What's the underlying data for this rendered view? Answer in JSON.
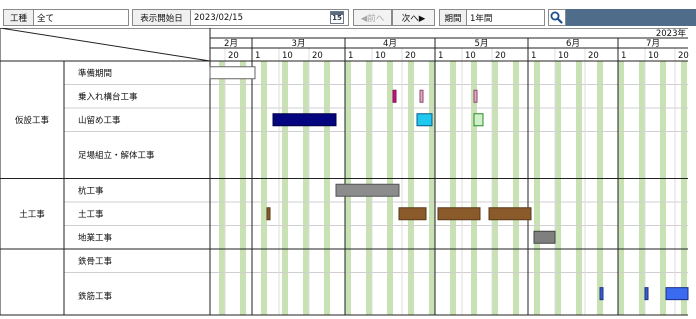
{
  "toolbar": {
    "type_label": "工種",
    "type_value": "全て",
    "start_label": "表示開始日",
    "start_value": "2023/02/15",
    "calendar_icon": "calendar-15-icon",
    "calendar_day": "15",
    "prev_label": "◀前へ",
    "next_label": "次へ▶",
    "period_label": "期間",
    "period_value": "1年間",
    "search_icon": "magnifier-icon"
  },
  "chart_data": {
    "type": "gantt",
    "year_label": "2023年",
    "start_date": "2023-02-15",
    "months": [
      {
        "label": "2月",
        "start": "2023-02-15",
        "end": "2023-03-01"
      },
      {
        "label": "3月",
        "start": "2023-03-01",
        "end": "2023-04-01"
      },
      {
        "label": "4月",
        "start": "2023-04-01",
        "end": "2023-05-01"
      },
      {
        "label": "5月",
        "start": "2023-05-01",
        "end": "2023-06-01"
      },
      {
        "label": "6月",
        "start": "2023-06-01",
        "end": "2023-07-01"
      },
      {
        "label": "7月",
        "start": "2023-07-01",
        "end": "2023-08-01"
      }
    ],
    "day_ticks": [
      {
        "date": "2023-02-20",
        "label": "20"
      },
      {
        "date": "2023-03-01",
        "label": "1"
      },
      {
        "date": "2023-03-10",
        "label": "10"
      },
      {
        "date": "2023-03-20",
        "label": "20"
      },
      {
        "date": "2023-04-01",
        "label": "1"
      },
      {
        "date": "2023-04-10",
        "label": "10"
      },
      {
        "date": "2023-04-20",
        "label": "20"
      },
      {
        "date": "2023-05-01",
        "label": "1"
      },
      {
        "date": "2023-05-10",
        "label": "10"
      },
      {
        "date": "2023-05-20",
        "label": "20"
      },
      {
        "date": "2023-06-01",
        "label": "1"
      },
      {
        "date": "2023-06-10",
        "label": "10"
      },
      {
        "date": "2023-06-20",
        "label": "20"
      },
      {
        "date": "2023-07-01",
        "label": "1"
      },
      {
        "date": "2023-07-10",
        "label": "10"
      },
      {
        "date": "2023-07-20",
        "label": "20"
      }
    ],
    "weekend_shading": true,
    "weekend_color": "#c8e2b4",
    "groups": [
      {
        "label": "仮設工事",
        "rows": [
          {
            "label": "準備期間",
            "height": 1,
            "bars": [
              {
                "start": "2023-02-15",
                "end": "2023-03-02",
                "color": "#ffffff",
                "stroke": "#666666",
                "lane": 0
              }
            ]
          },
          {
            "label": "乗入れ構台工事",
            "height": 1,
            "bars": [
              {
                "start": "2023-04-17",
                "end": "2023-04-18",
                "color": "#c0147d",
                "stroke": "#8a0f59",
                "lane": 0
              },
              {
                "start": "2023-04-26",
                "end": "2023-04-27",
                "color": "#e8a6c6",
                "stroke": "#8a4a6a",
                "lane": 0
              },
              {
                "start": "2023-05-14",
                "end": "2023-05-15",
                "color": "#e8a6c6",
                "stroke": "#8a4a6a",
                "lane": 0
              }
            ]
          },
          {
            "label": "山留め工事",
            "height": 1,
            "bars": [
              {
                "start": "2023-03-08",
                "end": "2023-03-29",
                "color": "#050580",
                "stroke": "#000040",
                "lane": 0
              },
              {
                "start": "2023-04-25",
                "end": "2023-04-30",
                "color": "#1ec8ee",
                "stroke": "#0a5a8a",
                "lane": 0
              },
              {
                "start": "2023-05-14",
                "end": "2023-05-17",
                "color": "#cdf0c8",
                "stroke": "#2a8a2a",
                "lane": 0
              }
            ]
          },
          {
            "label": "足場組立・解体工事",
            "height": 2,
            "bars": []
          }
        ]
      },
      {
        "label": "土工事",
        "rows": [
          {
            "label": "杭工事",
            "height": 1,
            "bars": [
              {
                "start": "2023-03-29",
                "end": "2023-04-19",
                "color": "#8c8c8c",
                "stroke": "#555555",
                "lane": 0
              }
            ]
          },
          {
            "label": "土工事",
            "height": 1,
            "bars": [
              {
                "start": "2023-03-06",
                "end": "2023-03-07",
                "color": "#8b5a2b",
                "stroke": "#5a3a1a",
                "lane": 0
              },
              {
                "start": "2023-04-19",
                "end": "2023-04-28",
                "color": "#8b5a2b",
                "stroke": "#5a3a1a",
                "lane": 0
              },
              {
                "start": "2023-05-02",
                "end": "2023-05-16",
                "color": "#8b5a2b",
                "stroke": "#5a3a1a",
                "lane": 0
              },
              {
                "start": "2023-05-19",
                "end": "2023-06-02",
                "color": "#8b5a2b",
                "stroke": "#5a3a1a",
                "lane": 0
              }
            ]
          },
          {
            "label": "地業工事",
            "height": 1,
            "bars": [
              {
                "start": "2023-06-03",
                "end": "2023-06-10",
                "color": "#7f7f7f",
                "stroke": "#444444",
                "lane": 0
              }
            ]
          }
        ]
      },
      {
        "label": "",
        "rows": [
          {
            "label": "鉄骨工事",
            "height": 1,
            "bars": []
          },
          {
            "label": "鉄筋工事",
            "height": 2,
            "bars": [
              {
                "start": "2023-06-25",
                "end": "2023-06-26",
                "color": "#3a5fd0",
                "stroke": "#1a3080",
                "lane": 0
              },
              {
                "start": "2023-07-10",
                "end": "2023-07-11",
                "color": "#3a5fd0",
                "stroke": "#1a3080",
                "lane": 0
              },
              {
                "start": "2023-07-17",
                "end": "2023-07-27",
                "color": "#3a6af0",
                "stroke": "#1a3080",
                "lane": 0
              }
            ]
          }
        ]
      }
    ]
  }
}
